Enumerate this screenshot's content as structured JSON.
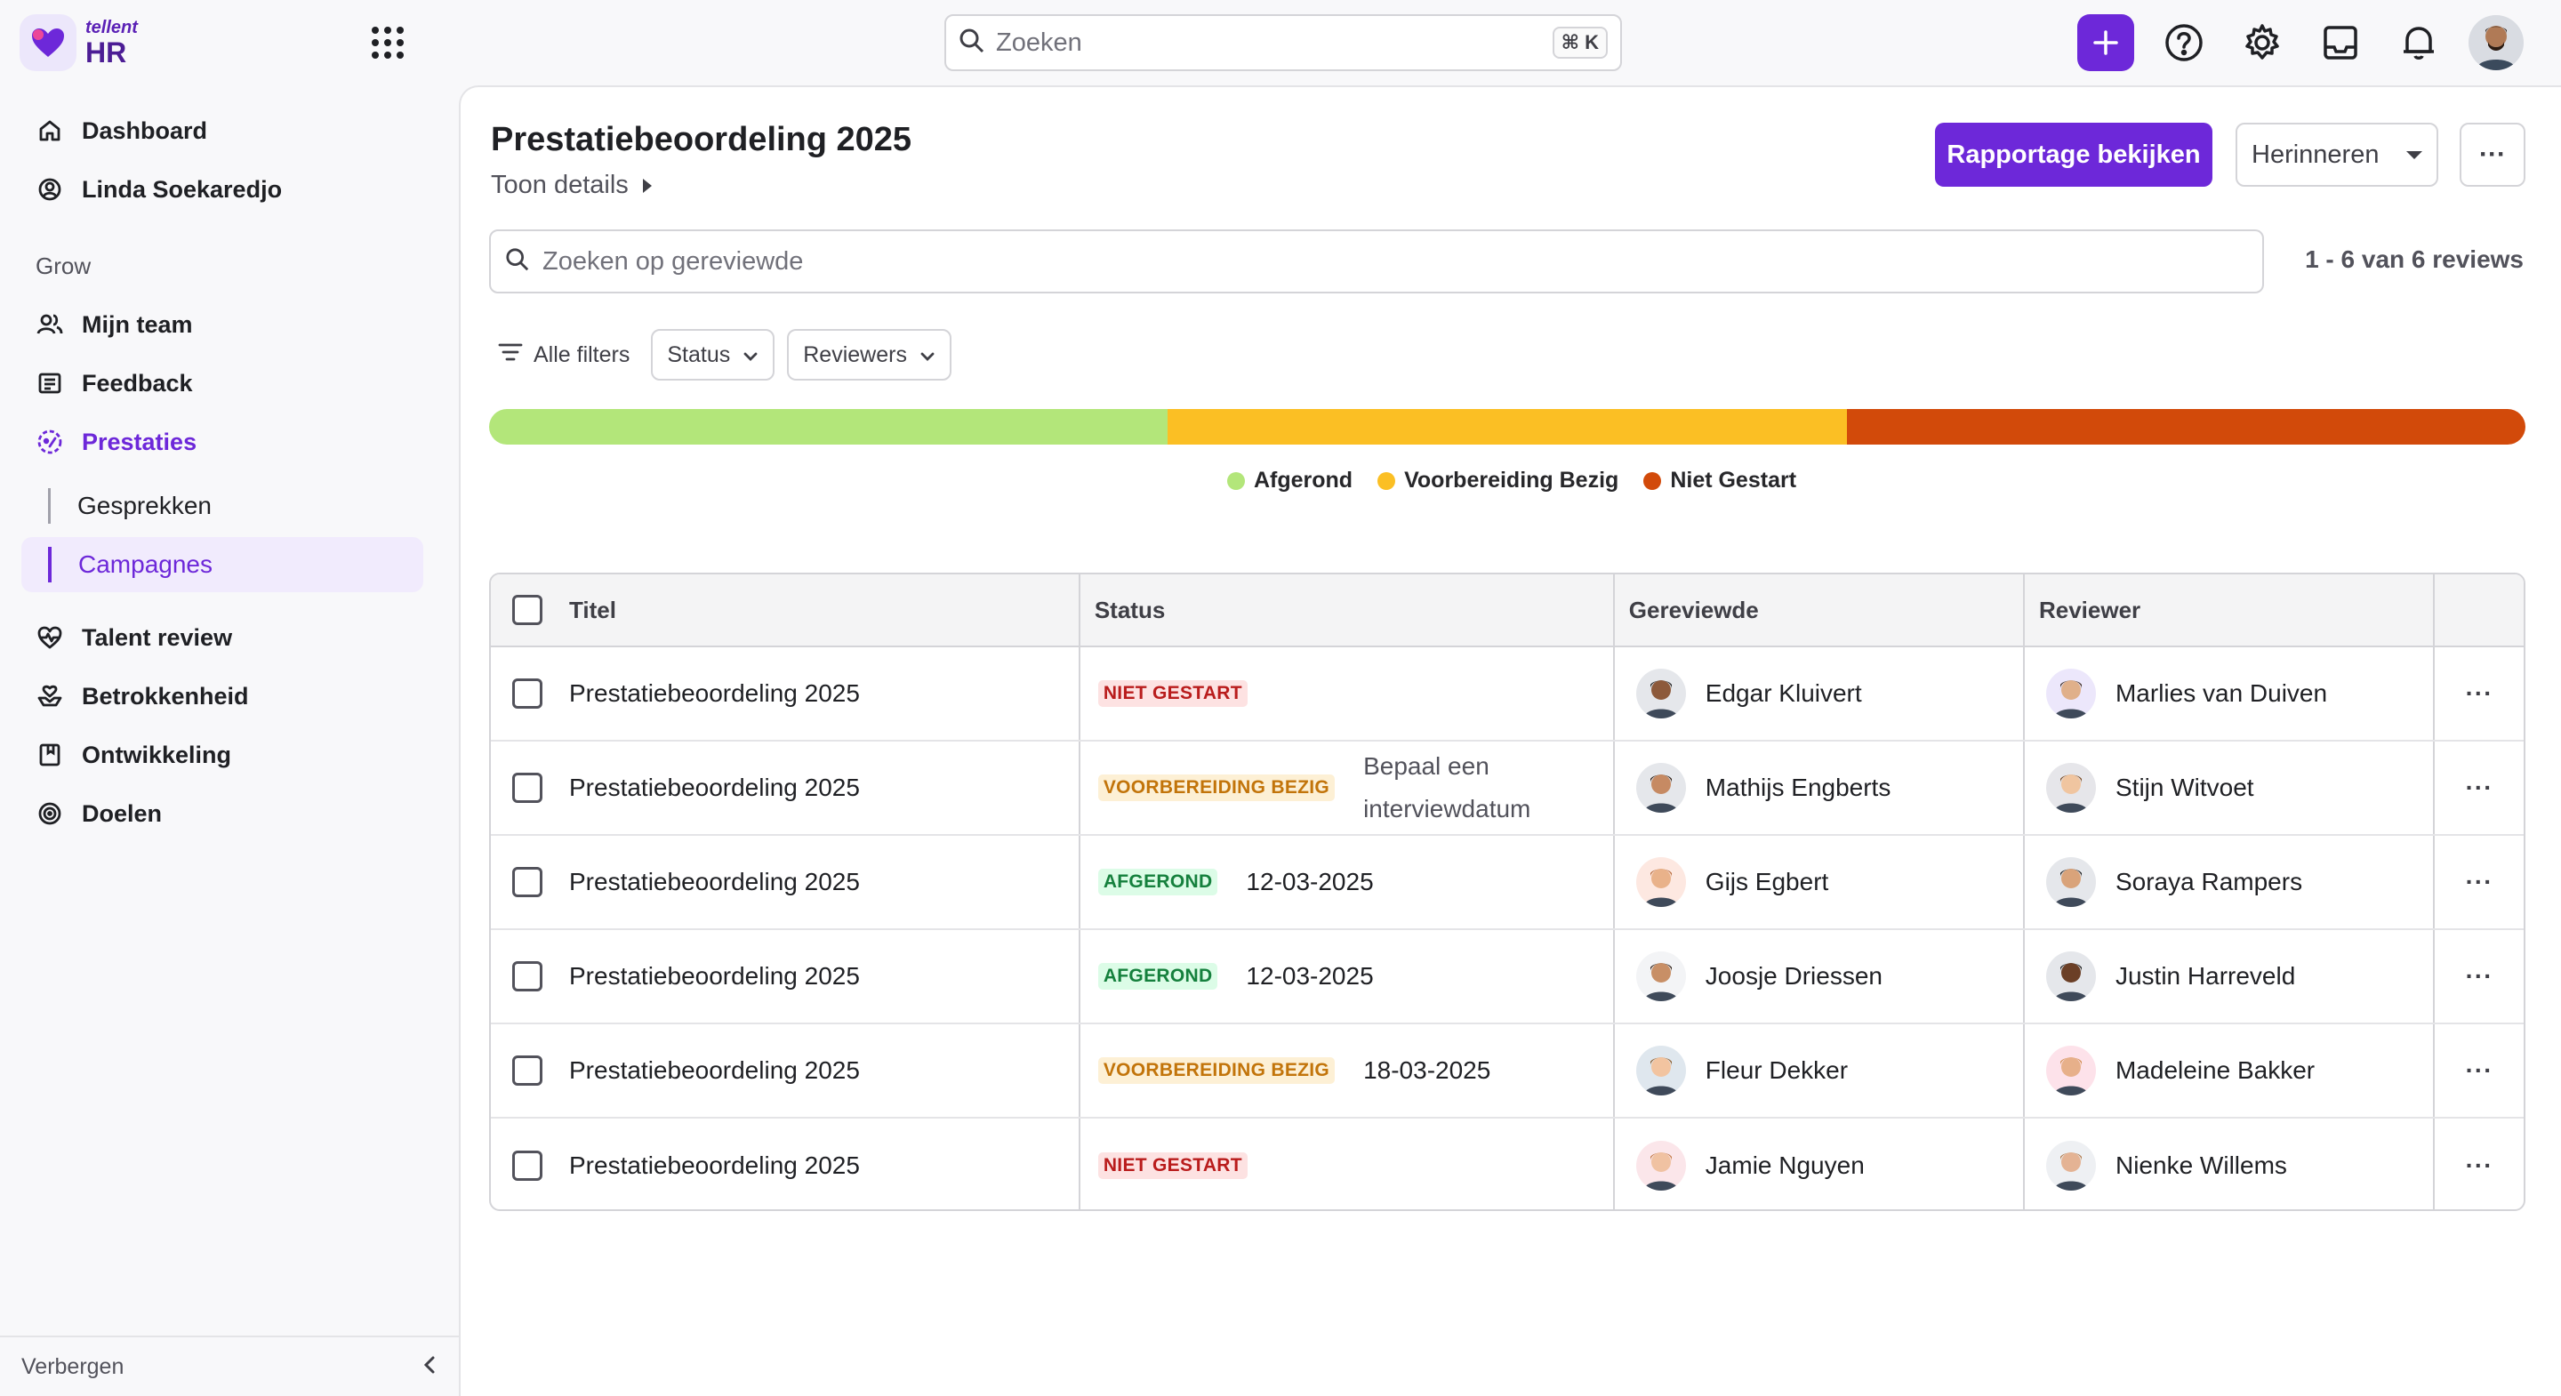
{
  "brand": {
    "small": "tellent",
    "big": "HR",
    "color": "#6d28d9"
  },
  "search": {
    "placeholder": "Zoeken",
    "shortcut": "⌘ K"
  },
  "sidebar": {
    "top_items": [
      {
        "label": "Dashboard",
        "icon": "home-icon"
      },
      {
        "label": "Linda Soekaredjo",
        "icon": "user-circle-icon"
      }
    ],
    "section_label": "Grow",
    "grow_items": [
      {
        "label": "Mijn team",
        "icon": "users-icon"
      },
      {
        "label": "Feedback",
        "icon": "message-icon"
      },
      {
        "label": "Prestaties",
        "icon": "performance-icon",
        "active": true
      }
    ],
    "sub_items": [
      {
        "label": "Gesprekken"
      },
      {
        "label": "Campagnes",
        "selected": true
      }
    ],
    "more_items": [
      {
        "label": "Talent review",
        "icon": "heart-pulse-icon"
      },
      {
        "label": "Betrokkenheid",
        "icon": "heart-hand-icon"
      },
      {
        "label": "Ontwikkeling",
        "icon": "book-icon"
      },
      {
        "label": "Doelen",
        "icon": "target-icon"
      }
    ],
    "footer_label": "Verbergen"
  },
  "page": {
    "title": "Prestatiebeoordeling 2025",
    "details_label": "Toon details",
    "primary_button": "Rapportage bekijken",
    "remind_button": "Herinneren",
    "more_button": "···",
    "review_search_placeholder": "Zoeken op gereviewde",
    "count": "1 - 6 van 6 reviews",
    "filters": {
      "all": "Alle filters",
      "status": "Status",
      "reviewers": "Reviewers"
    }
  },
  "progress": [
    {
      "label": "Afgerond",
      "fraction": 0.3333,
      "color": "#b3e67a"
    },
    {
      "label": "Voorbereiding Bezig",
      "fraction": 0.3334,
      "color": "#fbbf24"
    },
    {
      "label": "Niet Gestart",
      "fraction": 0.3333,
      "color": "#d24a0a"
    }
  ],
  "legend_colors": {
    "afgerond": "#b3e67a",
    "voorbereiding": "#fbbf24",
    "niet": "#d24a0a"
  },
  "table": {
    "headers": {
      "title": "Titel",
      "status": "Status",
      "gereviewde": "Gereviewde",
      "reviewer": "Reviewer"
    },
    "rows": [
      {
        "title": "Prestatiebeoordeling 2025",
        "status": "NIET GESTART",
        "status_type": "niet",
        "extra": "",
        "gereviewde": "Edgar Kluivert",
        "reviewer": "Marlies van Duiven",
        "more": "···"
      },
      {
        "title": "Prestatiebeoordeling 2025",
        "status": "VOORBEREIDING BEZIG",
        "status_type": "voor",
        "extra": "Bepaal een interviewdatum",
        "gereviewde": "Mathijs Engberts",
        "reviewer": "Stijn Witvoet",
        "more": "···"
      },
      {
        "title": "Prestatiebeoordeling 2025",
        "status": "AFGEROND",
        "status_type": "afg",
        "extra": "12-03-2025",
        "gereviewde": "Gijs Egbert",
        "reviewer": "Soraya Rampers",
        "more": "···"
      },
      {
        "title": "Prestatiebeoordeling 2025",
        "status": "AFGEROND",
        "status_type": "afg",
        "extra": "12-03-2025",
        "gereviewde": "Joosje Driessen",
        "reviewer": "Justin Harreveld",
        "more": "···"
      },
      {
        "title": "Prestatiebeoordeling 2025",
        "status": "VOORBEREIDING BEZIG",
        "status_type": "voor",
        "extra": "18-03-2025",
        "gereviewde": "Fleur Dekker",
        "reviewer": "Madeleine Bakker",
        "more": "···"
      },
      {
        "title": "Prestatiebeoordeling 2025",
        "status": "NIET GESTART",
        "status_type": "niet",
        "extra": "",
        "gereviewde": "Jamie Nguyen",
        "reviewer": "Nienke Willems",
        "more": "···"
      }
    ]
  }
}
